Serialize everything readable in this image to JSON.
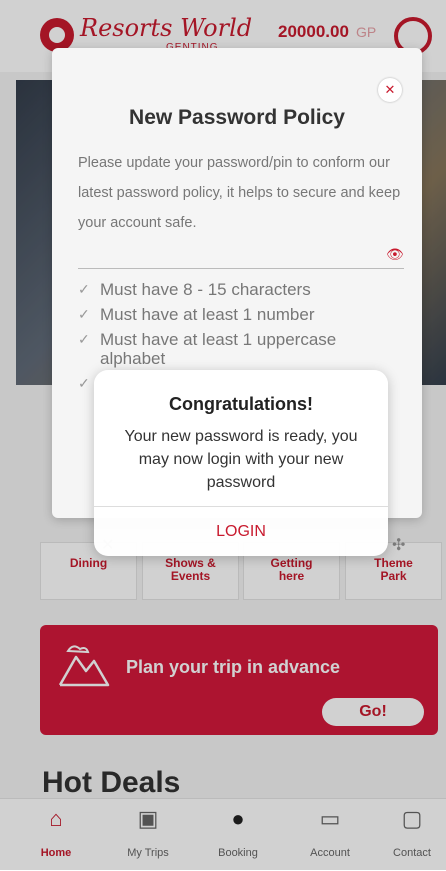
{
  "header": {
    "logo_text": "Resorts World",
    "logo_sub": "GENTING",
    "points": "20000.00",
    "points_unit": "GP"
  },
  "quick_links": [
    {
      "label": "Dining"
    },
    {
      "label": "Shows &\nEvents"
    },
    {
      "label": "Getting\nhere"
    },
    {
      "label": "Theme\nPark"
    }
  ],
  "plan": {
    "title": "Plan your trip in advance",
    "button": "Go!"
  },
  "hot_deals": "Hot Deals",
  "nav": [
    {
      "label": "Home",
      "icon": "home-icon",
      "active": true
    },
    {
      "label": "My Trips",
      "icon": "luggage-icon"
    },
    {
      "label": "Booking",
      "icon": "booking-logo-icon"
    },
    {
      "label": "Account",
      "icon": "card-icon"
    },
    {
      "label": "Contact",
      "icon": "chat-icon"
    }
  ],
  "policy": {
    "title": "New Password Policy",
    "description": "Please update your password/pin to conform our latest password policy, it helps to secure and keep your account safe.",
    "rules": [
      "Must have 8 - 15 characters",
      "Must have at least 1 number",
      "Must have at least 1 uppercase alphabet"
    ]
  },
  "congrats": {
    "title": "Congratulations!",
    "message": "Your new password is ready, you may now login with your new password",
    "button": "LOGIN"
  },
  "colors": {
    "brand": "#c81a2e",
    "plan_bg": "#d3193b"
  }
}
